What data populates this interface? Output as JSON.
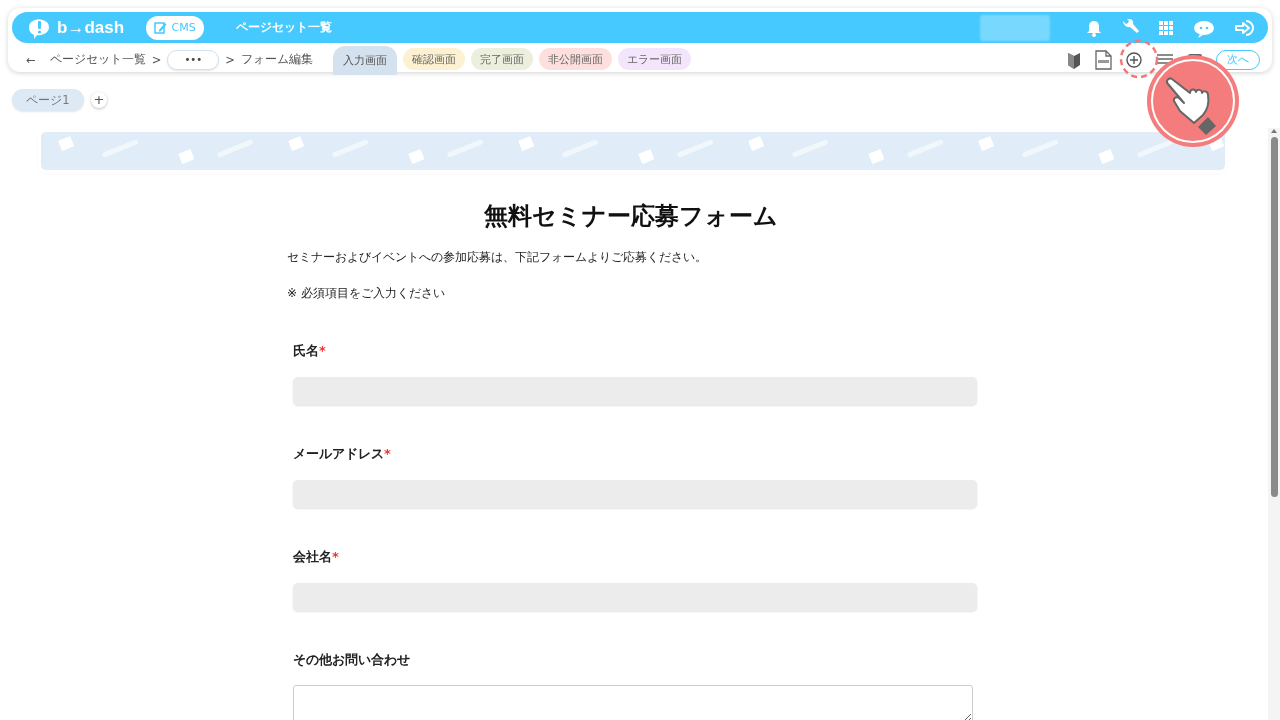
{
  "app": {
    "logo": "b→dash",
    "cms_button": "CMS",
    "title": "ページセット一覧"
  },
  "breadcrumb": {
    "back": "←",
    "items": [
      {
        "kind": "link",
        "label": "ページセット一覧"
      },
      {
        "kind": "sep",
        "label": ">"
      },
      {
        "kind": "more",
        "label": "•••"
      },
      {
        "kind": "sep",
        "label": ">"
      },
      {
        "kind": "text",
        "label": "フォーム編集"
      }
    ]
  },
  "screen_tabs": [
    {
      "label": "入力画面",
      "selected": true,
      "color": "#d3e2ee"
    },
    {
      "label": "確認画面",
      "selected": false,
      "color": "#fdf1d2"
    },
    {
      "label": "完了画面",
      "selected": false,
      "color": "#ebefdc"
    },
    {
      "label": "非公開画面",
      "selected": false,
      "color": "#fde0de"
    },
    {
      "label": "エラー画面",
      "selected": false,
      "color": "#f3e5fb"
    }
  ],
  "next_button": "次へ",
  "pages": {
    "items": [
      {
        "label": "ページ1",
        "selected": true
      }
    ],
    "add": "+"
  },
  "form": {
    "title": "無料セミナー応募フォーム",
    "intro": "セミナーおよびイベントへの参加応募は、下記フォームよりご応募ください。",
    "note": "※ 必須項目をご入力ください",
    "fields": [
      {
        "label": "氏名",
        "required_mark": "*",
        "kind": "input"
      },
      {
        "label": "メールアドレス",
        "required_mark": "*",
        "kind": "input"
      },
      {
        "label": "会社名",
        "required_mark": "*",
        "kind": "input"
      },
      {
        "label": "その他お問い合わせ",
        "kind": "textarea"
      }
    ]
  }
}
